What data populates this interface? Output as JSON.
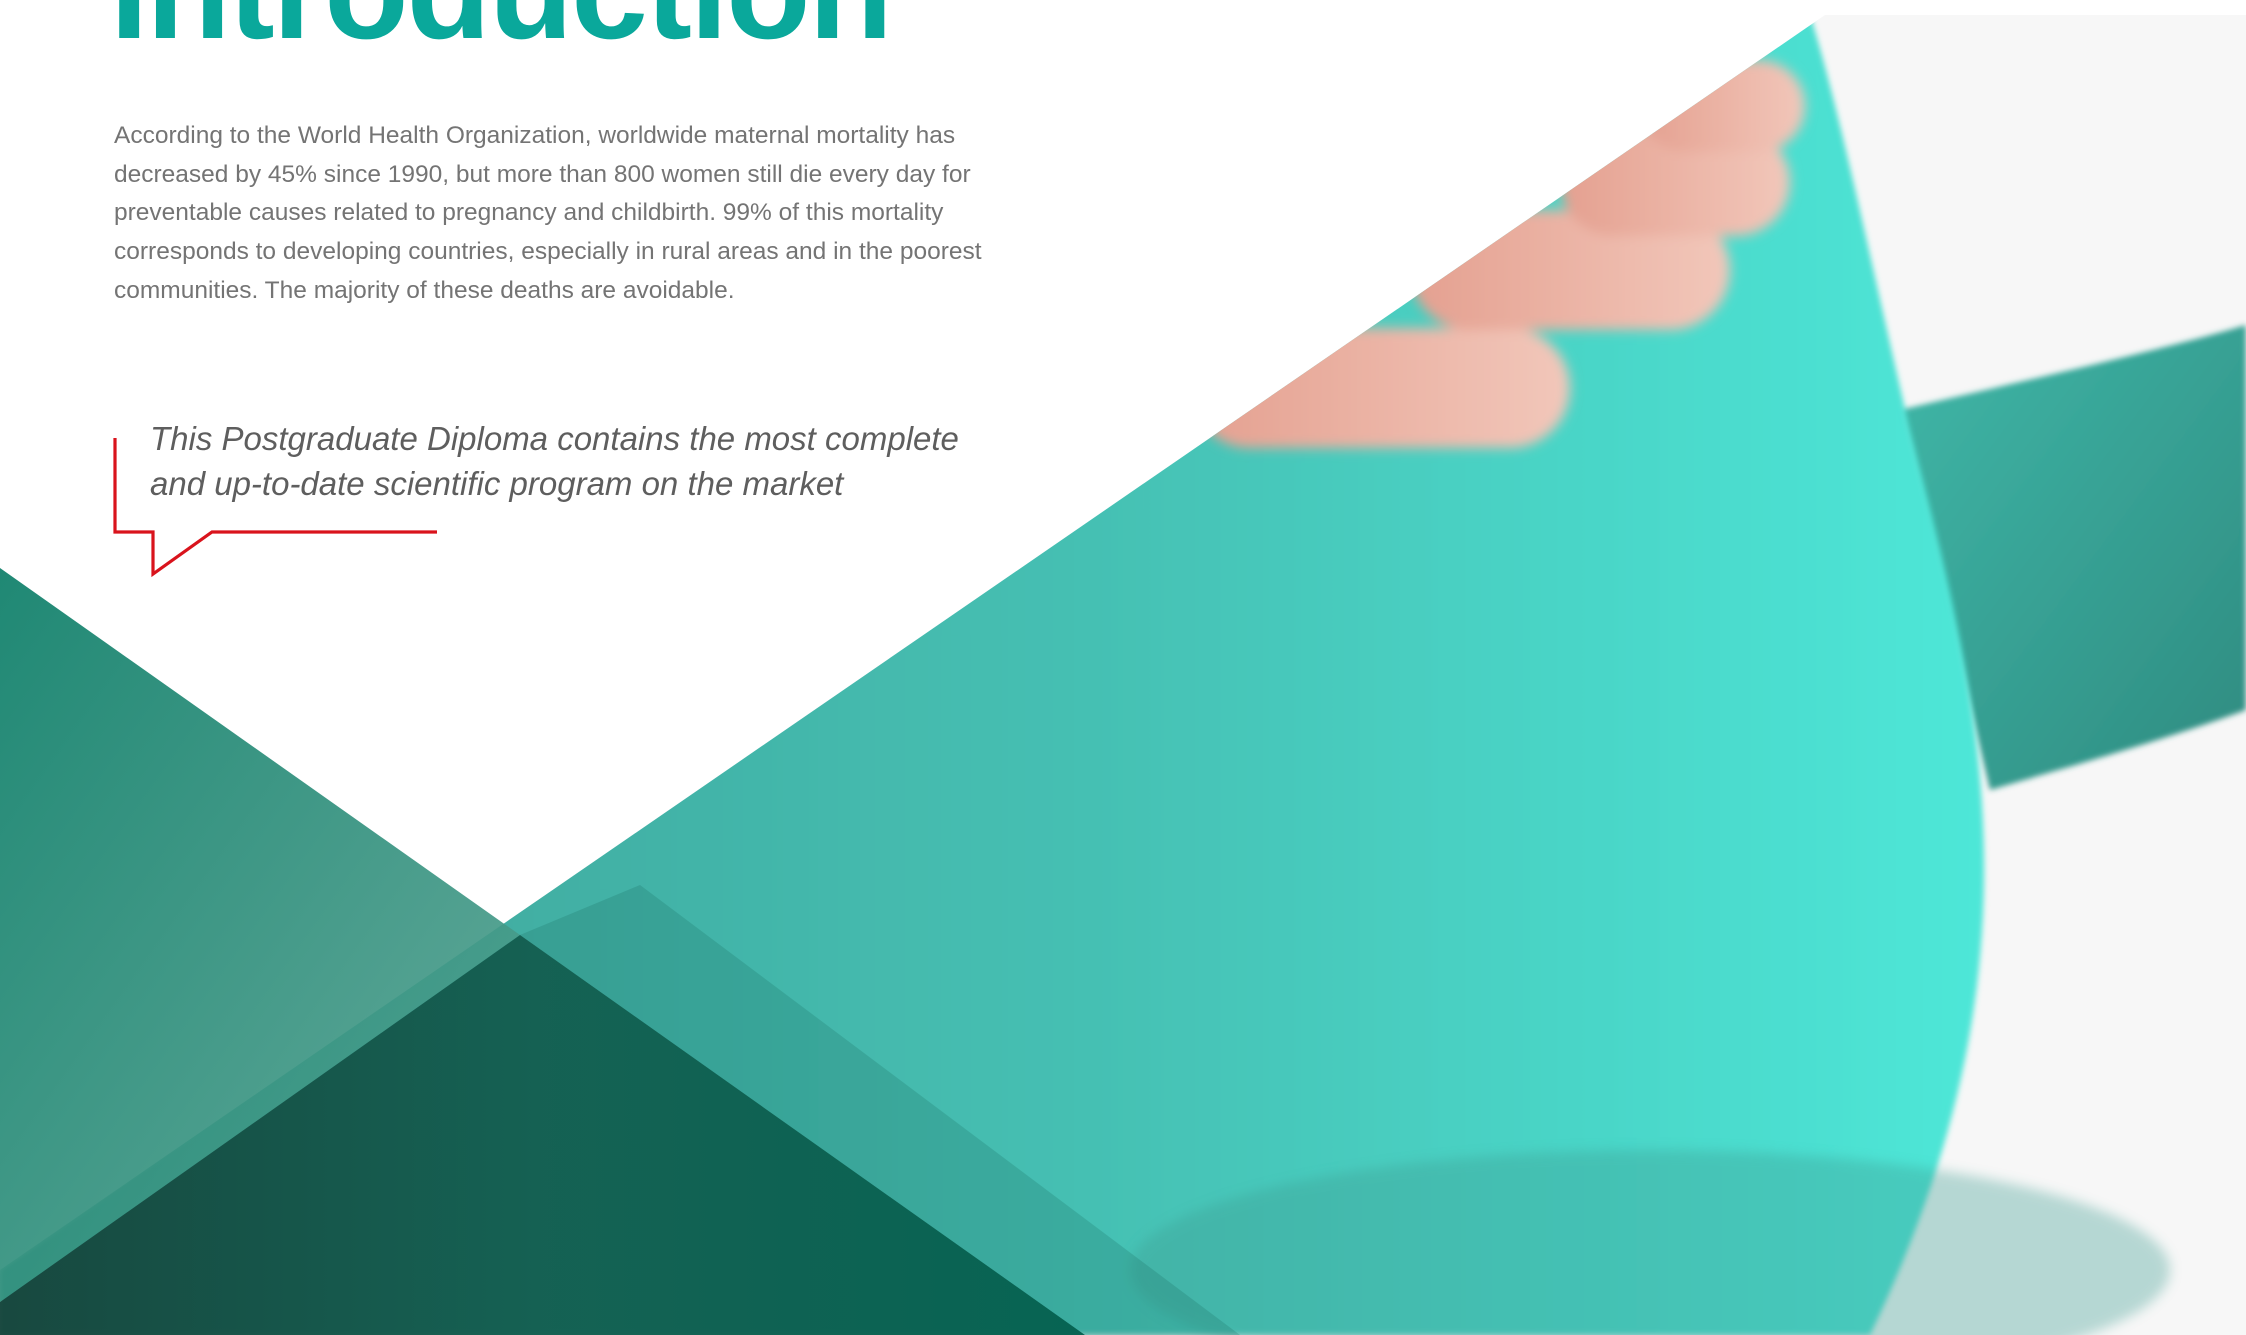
{
  "page": {
    "title": "Introduction",
    "intro_paragraph": "According to the World Health Organization, worldwide maternal mortality has decreased by 45% since 1990, but more than 800 women still die every day for preventable causes related to pregnancy and childbirth. 99% of this mortality corresponds to developing countries, especially in rural areas and in the poorest communities. The majority of these deaths are avoidable.",
    "quote": "This Postgraduate Diploma contains the most complete and up-to-date scientific program on the market"
  },
  "colors": {
    "title": "#0aa89b",
    "body_text": "#747474",
    "quote_text": "#5e5e5e",
    "callout_line": "#d9131c",
    "turquoise": "#3ecab9",
    "dark_green": "#0c5c4e"
  }
}
